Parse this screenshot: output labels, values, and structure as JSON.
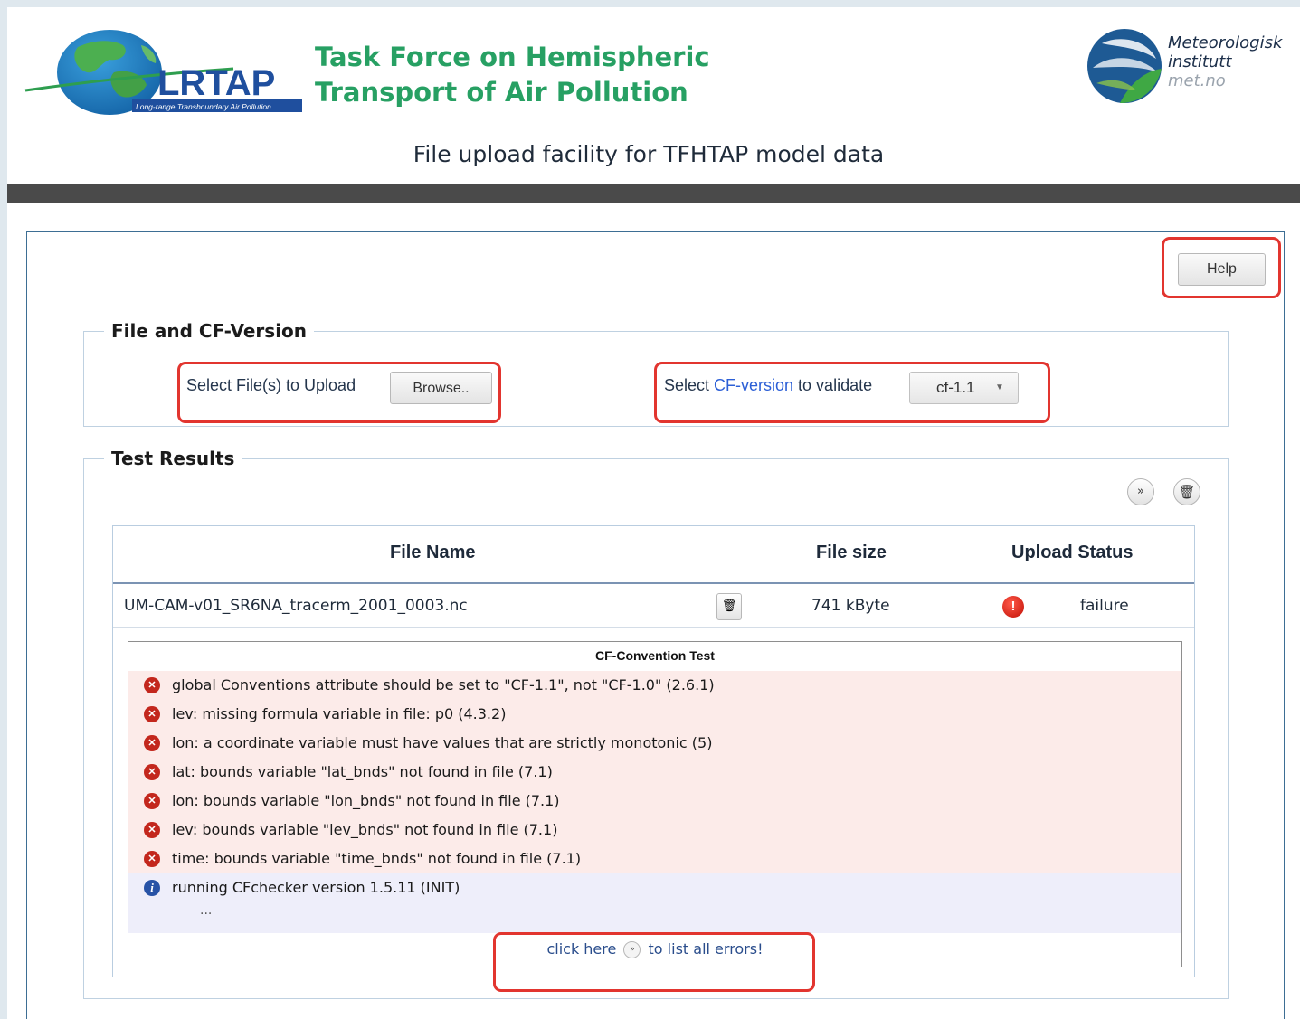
{
  "header": {
    "logo_text": "LRTAP",
    "logo_subtext": "Long-range Transboundary Air Pollution",
    "title_line1": "Task Force on Hemispheric",
    "title_line2": "Transport of Air Pollution",
    "institute_line1": "Meteorologisk",
    "institute_line2": "institutt",
    "institute_url": "met.no",
    "subtitle": "File upload facility for TFHTAP model data"
  },
  "toolbar": {
    "help_label": "Help"
  },
  "file_section": {
    "legend": "File and CF-Version",
    "select_files_label": "Select File(s) to Upload",
    "browse_label": "Browse..",
    "cf_label_prefix": "Select ",
    "cf_label_link": "CF-version",
    "cf_label_suffix": " to validate",
    "cf_selected": "cf-1.1"
  },
  "results": {
    "legend": "Test Results",
    "columns": {
      "file_name": "File Name",
      "file_size": "File size",
      "upload_status": "Upload Status"
    },
    "row": {
      "file_name": "UM-CAM-v01_SR6NA_tracerm_2001_0003.nc",
      "file_size": "741 kByte",
      "status": "failure"
    },
    "cf_test": {
      "title": "CF-Convention Test",
      "errors": [
        "global Conventions attribute should be set to \"CF-1.1\", not \"CF-1.0\" (2.6.1)",
        "lev: missing formula variable in file: p0 (4.3.2)",
        "lon: a coordinate variable must have values that are strictly monotonic (5)",
        "lat: bounds variable \"lat_bnds\" not found in file (7.1)",
        "lon: bounds variable \"lon_bnds\" not found in file (7.1)",
        "lev: bounds variable \"lev_bnds\" not found in file (7.1)",
        "time: bounds variable \"time_bnds\" not found in file (7.1)"
      ],
      "info": "running CFchecker version 1.5.11 (INIT)",
      "ellipsis": "...",
      "click_prefix": "click here",
      "click_suffix": "to list all errors!"
    }
  },
  "colors": {
    "accent_green": "#27a063",
    "highlight_red": "#e2352f",
    "error_bg": "#fcebe9",
    "info_bg": "#eeeefa"
  }
}
